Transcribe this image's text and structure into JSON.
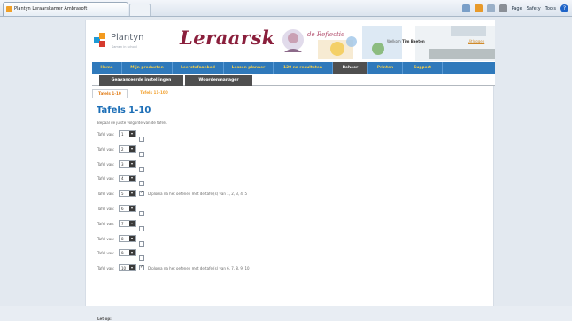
{
  "browser": {
    "tab_title": "Plantyn Leraarskamer Ambrasoft",
    "commands": [
      "Page",
      "Safety",
      "Tools"
    ]
  },
  "header": {
    "logo_text": "Plantyn",
    "logo_tagline": "Samen in school",
    "banner_title": "Leraarskamer",
    "welcome_prefix": "Welkom",
    "welcome_name": "Tim Baeten",
    "logout_label": "Uitloggen"
  },
  "nav": {
    "items": [
      {
        "label": "Home",
        "width": 34
      },
      {
        "label": "Mijn producten",
        "width": 57
      },
      {
        "label": "Leerstofaanbod",
        "width": 58
      },
      {
        "label": "Lessen planner",
        "width": 56
      },
      {
        "label": "120 na resultaten",
        "width": 67
      },
      {
        "label": "Beheer",
        "width": 40,
        "active": true
      },
      {
        "label": "Printen",
        "width": 39
      },
      {
        "label": "Support",
        "width": 45
      }
    ]
  },
  "subnav": {
    "items": [
      {
        "label": "Geavanceerde instellingen",
        "active": true
      },
      {
        "label": "Woordenmanager",
        "active": false
      }
    ]
  },
  "tabs": [
    {
      "label": "Tafels 1-10",
      "active": true
    },
    {
      "label": "Tafels 11-100",
      "active": false
    }
  ],
  "content": {
    "title": "Tafels 1-10",
    "intro": "Bepaal de juiste volgorde van de tafels.",
    "row_label": "Tafel van:",
    "rows": [
      {
        "value": "1",
        "diploma": false,
        "diploma_text": ""
      },
      {
        "value": "2",
        "diploma": false,
        "diploma_text": ""
      },
      {
        "value": "3",
        "diploma": false,
        "diploma_text": ""
      },
      {
        "value": "4",
        "diploma": false,
        "diploma_text": ""
      },
      {
        "value": "5",
        "diploma": true,
        "diploma_text": "Diploma na het oefenen met de tafel(s) van 1, 2, 3, 4, 5"
      },
      {
        "value": "6",
        "diploma": false,
        "diploma_text": ""
      },
      {
        "value": "7",
        "diploma": false,
        "diploma_text": ""
      },
      {
        "value": "8",
        "diploma": false,
        "diploma_text": ""
      },
      {
        "value": "9",
        "diploma": false,
        "diploma_text": ""
      },
      {
        "value": "10",
        "diploma": true,
        "diploma_text": "Diploma na het oefenen met de tafel(s) van 6, 7, 8, 9, 10"
      }
    ],
    "bottom_label": "Let op:"
  },
  "colors": {
    "nav_bg": "#2f79bb",
    "nav_text": "#f8d24a",
    "nav_active": "#4f4f4f",
    "title_blue": "#1d6fb7",
    "tab_orange": "#e07b15",
    "banner_maroon": "#8a1f3c"
  }
}
